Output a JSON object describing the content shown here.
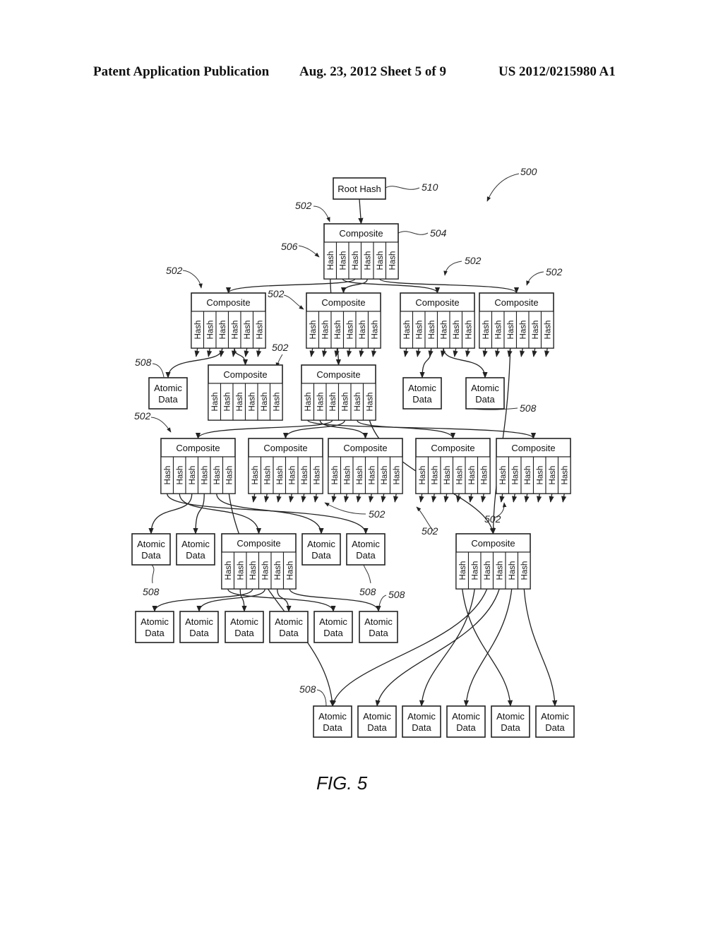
{
  "header": {
    "left": "Patent Application Publication",
    "middle": "Aug. 23, 2012  Sheet 5 of 9",
    "right": "US 2012/0215980 A1"
  },
  "figure": {
    "caption": "FIG. 5",
    "labels": {
      "root": "Root Hash",
      "composite": "Composite",
      "hash": "Hash",
      "atomic_line1": "Atomic",
      "atomic_line2": "Data"
    },
    "hash_slots_per_composite": 6,
    "nodes": [
      {
        "id": "root",
        "type": "root"
      },
      {
        "id": "c0",
        "type": "composite"
      },
      {
        "id": "c1a",
        "type": "composite"
      },
      {
        "id": "c1b",
        "type": "composite"
      },
      {
        "id": "c1c",
        "type": "composite"
      },
      {
        "id": "c1d",
        "type": "composite"
      },
      {
        "id": "c2a",
        "type": "composite"
      },
      {
        "id": "c2b",
        "type": "composite"
      },
      {
        "id": "a2a",
        "type": "atomic"
      },
      {
        "id": "a2b",
        "type": "atomic"
      },
      {
        "id": "a2c",
        "type": "atomic"
      },
      {
        "id": "c3a",
        "type": "composite"
      },
      {
        "id": "c3b",
        "type": "composite"
      },
      {
        "id": "c3c",
        "type": "composite"
      },
      {
        "id": "c3d",
        "type": "composite"
      },
      {
        "id": "c3e",
        "type": "composite"
      },
      {
        "id": "a4a",
        "type": "atomic"
      },
      {
        "id": "a4b",
        "type": "atomic"
      },
      {
        "id": "c4c",
        "type": "composite"
      },
      {
        "id": "a4d",
        "type": "atomic"
      },
      {
        "id": "a4e",
        "type": "atomic"
      },
      {
        "id": "c4f",
        "type": "composite"
      },
      {
        "id": "a5a",
        "type": "atomic"
      },
      {
        "id": "a5b",
        "type": "atomic"
      },
      {
        "id": "a5c",
        "type": "atomic"
      },
      {
        "id": "a5d",
        "type": "atomic"
      },
      {
        "id": "a5e",
        "type": "atomic"
      },
      {
        "id": "a5f",
        "type": "atomic"
      },
      {
        "id": "a6a",
        "type": "atomic"
      },
      {
        "id": "a6b",
        "type": "atomic"
      },
      {
        "id": "a6c",
        "type": "atomic"
      },
      {
        "id": "a6d",
        "type": "atomic"
      },
      {
        "id": "a6e",
        "type": "atomic"
      },
      {
        "id": "a6f",
        "type": "atomic"
      }
    ],
    "edges": [
      [
        "root",
        "c0"
      ],
      [
        "c0",
        "c1a"
      ],
      [
        "c0",
        "c1b"
      ],
      [
        "c0",
        "c1c"
      ],
      [
        "c0",
        "c1d"
      ],
      [
        "c0",
        "c2b"
      ],
      [
        "c1a",
        "a2a"
      ],
      [
        "c1a",
        "c2a"
      ],
      [
        "c1c",
        "a2b"
      ],
      [
        "c1c",
        "a2c"
      ],
      [
        "c1d",
        "c4f"
      ],
      [
        "c2b",
        "c3a"
      ],
      [
        "c2b",
        "c3b"
      ],
      [
        "c2b",
        "c3c"
      ],
      [
        "c2b",
        "c3d"
      ],
      [
        "c2b",
        "c3e"
      ],
      [
        "c2b",
        "c4f"
      ],
      [
        "c3a",
        "a4a"
      ],
      [
        "c3a",
        "a4b"
      ],
      [
        "c3a",
        "c4c"
      ],
      [
        "c3a",
        "a4d"
      ],
      [
        "c3a",
        "a4e"
      ],
      [
        "c3a",
        "a6a"
      ],
      [
        "c4c",
        "a5a"
      ],
      [
        "c4c",
        "a5b"
      ],
      [
        "c4c",
        "a5c"
      ],
      [
        "c4c",
        "a5d"
      ],
      [
        "c4c",
        "a5e"
      ],
      [
        "c4c",
        "a5f"
      ],
      [
        "c4f",
        "a6a"
      ],
      [
        "c4f",
        "a6b"
      ],
      [
        "c4f",
        "a6c"
      ],
      [
        "c4f",
        "a6d"
      ],
      [
        "c4f",
        "a6e"
      ],
      [
        "c4f",
        "a6f"
      ]
    ],
    "reference_numerals": [
      {
        "id": "ref-500",
        "text": "500"
      },
      {
        "id": "ref-510",
        "text": "510"
      },
      {
        "id": "ref-504",
        "text": "504"
      },
      {
        "id": "ref-506",
        "text": "506"
      },
      {
        "id": "ref-502-a",
        "text": "502"
      },
      {
        "id": "ref-502-b",
        "text": "502"
      },
      {
        "id": "ref-502-c",
        "text": "502"
      },
      {
        "id": "ref-502-d",
        "text": "502"
      },
      {
        "id": "ref-502-e",
        "text": "502"
      },
      {
        "id": "ref-502-f",
        "text": "502"
      },
      {
        "id": "ref-502-g",
        "text": "502"
      },
      {
        "id": "ref-502-h",
        "text": "502"
      },
      {
        "id": "ref-502-i",
        "text": "502"
      },
      {
        "id": "ref-502-j",
        "text": "502"
      },
      {
        "id": "ref-508-a",
        "text": "508"
      },
      {
        "id": "ref-508-b",
        "text": "508"
      },
      {
        "id": "ref-508-c",
        "text": "508"
      },
      {
        "id": "ref-508-d",
        "text": "508"
      },
      {
        "id": "ref-508-e",
        "text": "508"
      },
      {
        "id": "ref-508-f",
        "text": "508"
      }
    ]
  }
}
